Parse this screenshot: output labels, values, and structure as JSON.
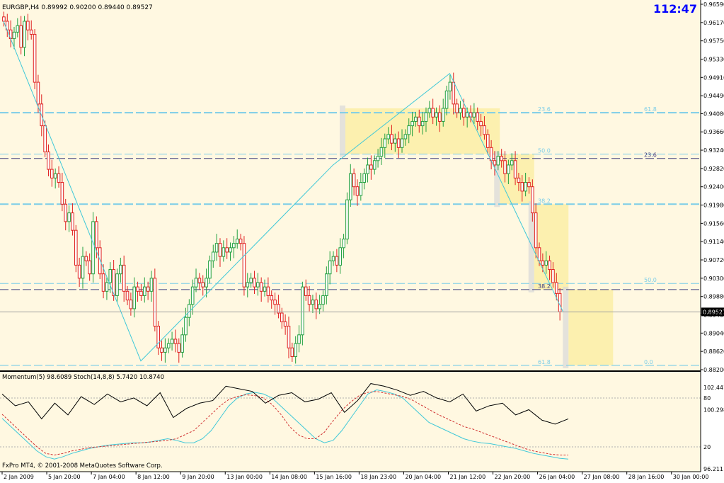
{
  "window": {
    "symbol_line": "EURGBP,H4  0.89992 0.90200 0.89440 0.89527",
    "clock": "112:47",
    "copyright": "FxPro MT4, © 2001-2008 MetaQuotes Software Corp."
  },
  "colors": {
    "background": "#fff8e1",
    "up_candle": "#22a040",
    "down_candle": "#e02020",
    "fib_zone": "#fbeea6",
    "grey_zone": "#d8d8d8",
    "light_blue": "#7ccde8",
    "dark_blue": "#404080",
    "cyan": "#40c8d8",
    "dot_red": "#d03030",
    "axis": "#000000"
  },
  "chart_data": [
    {
      "type": "candlestick",
      "title": "EURGBP,H4",
      "ohlc_last": {
        "open": 0.89992,
        "high": 0.902,
        "low": 0.8944,
        "close": 0.89527
      },
      "current_price": "0.89527",
      "ylim": [
        0.882,
        0.9659
      ],
      "y_ticks": [
        "0.96590",
        "0.96170",
        "0.95750",
        "0.95330",
        "0.94910",
        "0.94490",
        "0.94080",
        "0.93660",
        "0.93240",
        "0.92820",
        "0.92400",
        "0.91980",
        "0.91560",
        "0.91140",
        "0.90720",
        "0.90300",
        "0.89880",
        "0.89460",
        "0.89040",
        "0.88620",
        "0.88200"
      ],
      "x_labels": [
        "2 Jan 2009",
        "5 Jan 20:00",
        "7 Jan 04:00",
        "8 Jan 12:00",
        "9 Jan 20:00",
        "13 Jan 00:00",
        "14 Jan 08:00",
        "15 Jan 16:00",
        "18 Jan 23:00",
        "20 Jan 04:00",
        "21 Jan 12:00",
        "22 Jan 20:00",
        "26 Jan 04:00",
        "27 Jan 08:00",
        "28 Jan 16:00",
        "30 Jan 00:00"
      ],
      "x_label_bars": [
        0,
        13,
        26,
        39,
        52,
        65,
        78,
        91,
        104,
        117,
        130,
        143,
        156,
        169,
        182,
        195
      ],
      "closes": [
        0.962,
        0.96,
        0.958,
        0.9595,
        0.961,
        0.956,
        0.962,
        0.96,
        0.959,
        0.948,
        0.943,
        0.938,
        0.932,
        0.928,
        0.926,
        0.927,
        0.925,
        0.92,
        0.916,
        0.918,
        0.914,
        0.906,
        0.903,
        0.908,
        0.907,
        0.904,
        0.916,
        0.91,
        0.904,
        0.9,
        0.902,
        0.905,
        0.899,
        0.904,
        0.906,
        0.9,
        0.898,
        0.896,
        0.901,
        0.9,
        0.899,
        0.901,
        0.9,
        0.903,
        0.892,
        0.887,
        0.886,
        0.887,
        0.888,
        0.889,
        0.888,
        0.886,
        0.89,
        0.894,
        0.897,
        0.901,
        0.903,
        0.902,
        0.901,
        0.903,
        0.907,
        0.909,
        0.911,
        0.908,
        0.91,
        0.909,
        0.91,
        0.911,
        0.912,
        0.911,
        0.901,
        0.902,
        0.903,
        0.901,
        0.902,
        0.9,
        0.901,
        0.899,
        0.898,
        0.897,
        0.895,
        0.893,
        0.892,
        0.887,
        0.885,
        0.888,
        0.89,
        0.901,
        0.899,
        0.897,
        0.898,
        0.896,
        0.897,
        0.899,
        0.904,
        0.907,
        0.908,
        0.906,
        0.91,
        0.912,
        0.921,
        0.927,
        0.924,
        0.922,
        0.925,
        0.927,
        0.929,
        0.928,
        0.93,
        0.931,
        0.933,
        0.935,
        0.936,
        0.934,
        0.935,
        0.933,
        0.935,
        0.936,
        0.938,
        0.939,
        0.94,
        0.938,
        0.939,
        0.941,
        0.942,
        0.94,
        0.941,
        0.939,
        0.942,
        0.946,
        0.948,
        0.943,
        0.941,
        0.942,
        0.94,
        0.941,
        0.94,
        0.941,
        0.939,
        0.938,
        0.936,
        0.933,
        0.93,
        0.929,
        0.931,
        0.93,
        0.927,
        0.929,
        0.93,
        0.926,
        0.925,
        0.923,
        0.925,
        0.924,
        0.918,
        0.91,
        0.907,
        0.906,
        0.907,
        0.905,
        0.902,
        0.8995,
        0.8953
      ],
      "fibonacci_levels": [
        {
          "label": "23.6",
          "price": 0.941
        },
        {
          "label": "61.8",
          "price": 0.941
        },
        {
          "label": "50.0",
          "price": 0.9315
        },
        {
          "label": "23.6",
          "price": 0.9305
        },
        {
          "label": "38.2",
          "price": 0.92
        },
        {
          "label": "50.0",
          "price": 0.9018
        },
        {
          "label": "38.2",
          "price": 0.9004
        },
        {
          "label": "0.0",
          "price": 0.883
        },
        {
          "label": "61.8",
          "price": 0.883
        }
      ]
    },
    {
      "type": "line",
      "title": "Momentum(5) 98.6089  Stoch(14,8,8) 5.7420 10.8740",
      "y_ticks": [
        "102.4418",
        "80",
        "100.2988",
        "20",
        "96.211"
      ],
      "levels": [
        80,
        20
      ],
      "stoch_k": [
        55,
        45,
        35,
        25,
        15,
        8,
        5,
        8,
        12,
        15,
        18,
        20,
        22,
        23,
        24,
        25,
        25,
        26,
        28,
        30,
        28,
        25,
        25,
        30,
        40,
        55,
        70,
        80,
        85,
        87,
        85,
        80,
        70,
        60,
        50,
        40,
        30,
        25,
        28,
        40,
        55,
        70,
        85,
        90,
        88,
        85,
        80,
        70,
        60,
        50,
        45,
        40,
        35,
        30,
        27,
        25,
        24,
        22,
        20,
        18,
        15,
        12,
        10,
        8,
        6,
        5
      ],
      "stoch_d": [
        60,
        50,
        40,
        30,
        20,
        12,
        10,
        12,
        15,
        17,
        19,
        20,
        21,
        22,
        23,
        24,
        25,
        26,
        27,
        28,
        30,
        35,
        40,
        50,
        60,
        70,
        78,
        82,
        84,
        83,
        80,
        72,
        60,
        45,
        35,
        30,
        30,
        38,
        52,
        65,
        75,
        83,
        87,
        88,
        86,
        84,
        82,
        78,
        72,
        66,
        60,
        55,
        50,
        45,
        42,
        38,
        34,
        30,
        26,
        22,
        18,
        15,
        13,
        11,
        10,
        10
      ],
      "momentum": [
        101.5,
        100.6,
        100.9,
        99.6,
        100.8,
        99.9,
        101.3,
        100.7,
        101.5,
        100.9,
        101.2,
        100.6,
        101.6,
        99.7,
        100.4,
        100.8,
        101.0,
        102.1,
        101.9,
        101.7,
        100.8,
        101.4,
        101.6,
        100.9,
        101.1,
        101.6,
        100.1,
        101.0,
        102.3,
        102.1,
        101.8,
        101.4,
        101.7,
        101.2,
        100.9,
        101.5,
        100.2,
        100.6,
        100.8,
        99.9,
        100.3,
        99.5,
        99.2,
        99.6
      ]
    }
  ]
}
